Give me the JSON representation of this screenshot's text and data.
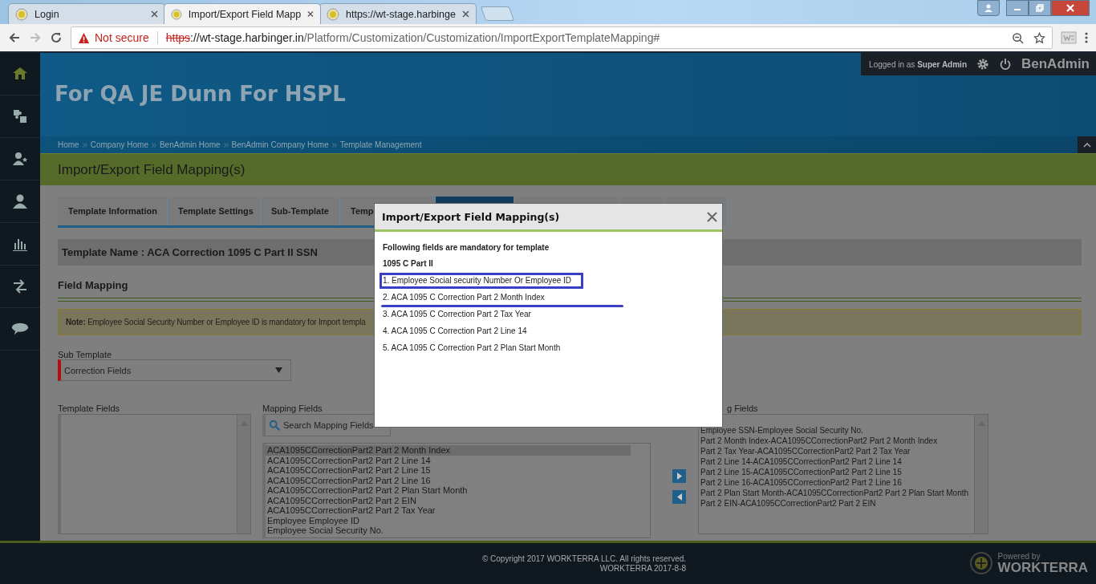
{
  "browser": {
    "tabs": [
      {
        "title": "Login",
        "selected": false
      },
      {
        "title": "Import/Export Field Mapp",
        "selected": true
      },
      {
        "title": "https://wt-stage.harbinge",
        "selected": false
      }
    ],
    "security": "Not secure",
    "url_scheme": "https",
    "url_host": "://wt-stage.harbinger.in",
    "url_path": "/Platform/Customization/Customization/ImportExportTemplateMapping#"
  },
  "header": {
    "company": "For QA JE Dunn For HSPL",
    "logged_in_label": "Logged in as",
    "user": "Super Admin",
    "app": "BenAdmin"
  },
  "breadcrumb": [
    "Home",
    "Company Home",
    "BenAdmin Home",
    "BenAdmin Company Home",
    "Template Management"
  ],
  "page_title": "Import/Export Field Mapping(s)",
  "tabs": [
    {
      "label": "Template Information",
      "selected": false
    },
    {
      "label": "Template Settings",
      "selected": false
    },
    {
      "label": "Sub-Template",
      "selected": false
    },
    {
      "label": "Temp",
      "selected": false
    },
    {
      "selected": true
    },
    {
      "selected": false
    },
    {
      "selected": false
    },
    {
      "selected": false
    }
  ],
  "template_name": "Template Name : ACA Correction 1095 C Part II SSN",
  "section_title": "Field Mapping",
  "note": {
    "label": "Note:",
    "text": "Employee Social Security Number or Employee ID is mandatory for Import templa"
  },
  "sub_template": {
    "label": "Sub Template",
    "value": "Correction Fields"
  },
  "template_fields": {
    "label": "Template Fields"
  },
  "mapping_fields": {
    "label": "Mapping Fields",
    "placeholder": "Search Mapping Fields",
    "items": [
      {
        "text": "ACA1095CCorrectionPart2 Part 2 Month Index",
        "selected": true
      },
      {
        "text": "ACA1095CCorrectionPart2 Part 2 Line 14",
        "selected": false
      },
      {
        "text": "ACA1095CCorrectionPart2 Part 2 Line 15",
        "selected": false
      },
      {
        "text": "ACA1095CCorrectionPart2 Part 2 Line 16",
        "selected": false
      },
      {
        "text": "ACA1095CCorrectionPart2 Part 2 Plan Start Month",
        "selected": false
      },
      {
        "text": "ACA1095CCorrectionPart2 Part 2 EIN",
        "selected": false
      },
      {
        "text": "ACA1095CCorrectionPart2 Part 2 Tax Year",
        "selected": false
      },
      {
        "text": "Employee Employee ID",
        "selected": false
      },
      {
        "text": "Employee Social Security No.",
        "selected": false
      }
    ]
  },
  "mapped_fields": {
    "label": "g Fields",
    "items": [
      "Employee SSN-Employee Social Security No.",
      "Part 2 Month Index-ACA1095CCorrectionPart2 Part 2 Month Index",
      "Part 2 Tax Year-ACA1095CCorrectionPart2 Part 2 Tax Year",
      "Part 2 Line 14-ACA1095CCorrectionPart2 Part 2 Line 14",
      "Part 2 Line 15-ACA1095CCorrectionPart2 Part 2 Line 15",
      "Part 2 Line 16-ACA1095CCorrectionPart2 Part 2 Line 16",
      "Part 2 Plan Start Month-ACA1095CCorrectionPart2 Part 2 Plan Start Month",
      "Part 2 EIN-ACA1095CCorrectionPart2 Part 2 EIN"
    ]
  },
  "footer": {
    "copyright": "© Copyright 2017 WORKTERRA LLC. All rights reserved.",
    "version": "WORKTERRA 2017-8-8",
    "powered_by": "Powered by",
    "brand": "WORKTERRA"
  },
  "modal": {
    "title": "Import/Export Field Mapping(s)",
    "intro": "Following fields are mandatory for template",
    "template": "1095 C Part II",
    "fields": [
      {
        "text": "1. Employee Social security Number Or Employee ID",
        "highlighted": true
      },
      {
        "text": "2. ACA 1095 C Correction Part 2 Month Index",
        "highlighted": false
      },
      {
        "text": "3. ACA 1095 C Correction Part 2 Tax Year",
        "highlighted": false
      },
      {
        "text": "4. ACA 1095 C Correction Part 2 Line 14",
        "highlighted": false
      },
      {
        "text": "5. ACA 1095 C Correction Part 2 Plan Start Month",
        "highlighted": false
      }
    ]
  }
}
